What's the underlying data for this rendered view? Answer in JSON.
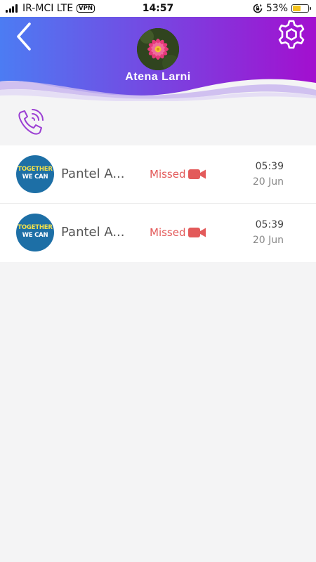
{
  "status_bar": {
    "carrier": "IR-MCI LTE",
    "vpn": "VPN",
    "time": "14:57",
    "battery_percent": "53%",
    "battery_level": 0.53,
    "icons": [
      "signal-icon",
      "vpn-icon",
      "rotation-lock-icon",
      "battery-icon"
    ]
  },
  "header": {
    "contact_name": "Atena Larni",
    "gradient_start": "#4c7cf3",
    "gradient_end": "#a30fcf",
    "icons": [
      "back-icon",
      "settings-icon",
      "avatar-flower-image"
    ]
  },
  "filter": {
    "icon": "wifi-calling-icon",
    "color": "#9b3fd3"
  },
  "calls": [
    {
      "avatar_line1": "TOGETHER",
      "avatar_line2": "WE CAN",
      "name": "Pantel A...",
      "status": "Missed",
      "type_icon": "video-camera-icon",
      "time": "05:39",
      "date": "20 Jun"
    },
    {
      "avatar_line1": "TOGETHER",
      "avatar_line2": "WE CAN",
      "name": "Pantel A...",
      "status": "Missed",
      "type_icon": "video-camera-icon",
      "time": "05:39",
      "date": "20 Jun"
    }
  ],
  "colors": {
    "missed": "#e35a5a",
    "background": "#f4f4f5"
  }
}
